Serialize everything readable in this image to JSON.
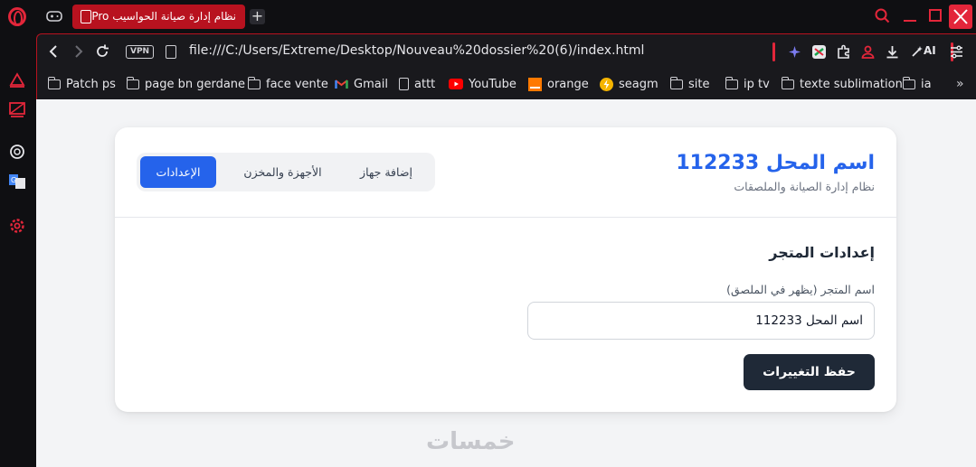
{
  "browser": {
    "tab": {
      "title": "نظام إدارة صيانة الحواسيب Pro"
    },
    "new_tab_label": "+",
    "address_bar": {
      "vpn_label": "VPN",
      "url": "file:///C:/Users/Extreme/Desktop/Nouveau%20dossier%20(6)/index.html"
    },
    "ai_label": "AI",
    "bookmarks": [
      {
        "label": "Patch ps",
        "icon": "folder-icon"
      },
      {
        "label": "page bn gerdane",
        "icon": "folder-icon"
      },
      {
        "label": "face vente",
        "icon": "folder-icon"
      },
      {
        "label": "Gmail",
        "icon": "gmail-icon"
      },
      {
        "label": "attt",
        "icon": "document-icon"
      },
      {
        "label": "YouTube",
        "icon": "youtube-icon"
      },
      {
        "label": "orange",
        "icon": "orange-icon"
      },
      {
        "label": "seagm",
        "icon": "seagm-icon"
      },
      {
        "label": "site",
        "icon": "folder-icon"
      },
      {
        "label": "ip tv",
        "icon": "folder-icon"
      },
      {
        "label": "texte sublimation",
        "icon": "folder-icon"
      },
      {
        "label": "ia",
        "icon": "folder-icon"
      }
    ],
    "more_bookmarks_label": "»"
  },
  "app": {
    "header": {
      "title": "اسم المحل 112233",
      "subtitle": "نظام إدارة الصيانة والملصقات"
    },
    "tabs": [
      {
        "label": "إضافة جهاز",
        "active": false
      },
      {
        "label": "الأجهزة والمخزن",
        "active": false
      },
      {
        "label": "الإعدادات",
        "active": true
      }
    ],
    "settings": {
      "section_title": "إعدادات المتجر",
      "store_name_label": "اسم المتجر (يظهر في الملصق)",
      "store_name_value": "اسم المحل 112233",
      "save_label": "حفظ التغييرات"
    },
    "watermark": "خمسات"
  },
  "colors": {
    "accent": "#2563eb",
    "browser_accent": "#e3263a",
    "save_button": "#1f2937"
  }
}
